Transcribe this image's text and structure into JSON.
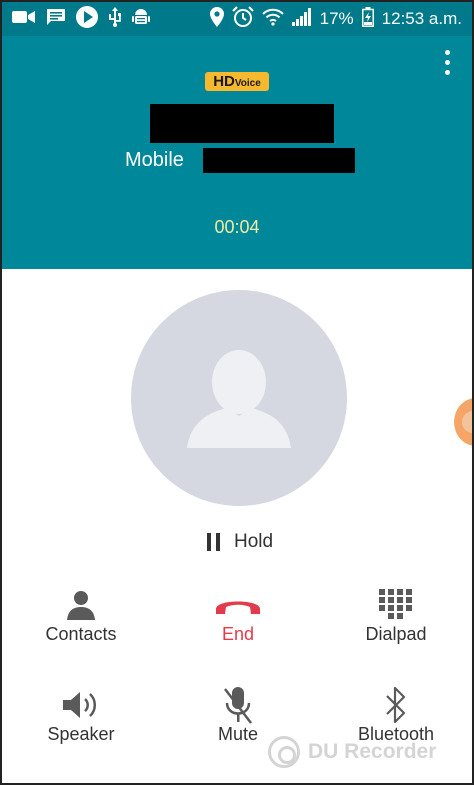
{
  "status_bar": {
    "left_icons": [
      "video-call-icon",
      "message-icon",
      "play-icon",
      "usb-icon",
      "android-debug-icon"
    ],
    "right_icons": [
      "location-icon",
      "alarm-icon",
      "wifi-icon",
      "signal-icon",
      "battery-icon"
    ],
    "battery_percent": "17%",
    "time": "12:53 a.m."
  },
  "call": {
    "hd_badge_main": "HD",
    "hd_badge_sub": "Voice",
    "caller_name": "",
    "number_label": "Mobile",
    "phone_number": "",
    "duration": "00:04"
  },
  "hold": {
    "label": "Hold"
  },
  "actions": {
    "contacts": "Contacts",
    "end": "End",
    "dialpad": "Dialpad",
    "speaker": "Speaker",
    "mute": "Mute",
    "bluetooth": "Bluetooth"
  },
  "watermark": {
    "text": "DU Recorder"
  },
  "colors": {
    "header": "#00879a",
    "status_bar": "#007a8a",
    "end_call": "#e23b4c",
    "timer": "#f2eda0",
    "hd_badge": "#f5b82e",
    "avatar_bg": "#d6d8e1"
  }
}
